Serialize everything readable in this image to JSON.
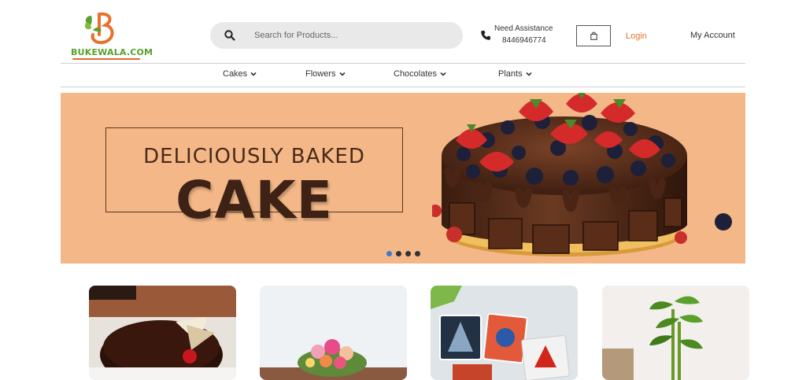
{
  "brand": {
    "name": "BUKEWALA.COM",
    "primary_green": "#5aa02c",
    "accent_orange": "#e8702a"
  },
  "search": {
    "placeholder": "Search for Products..."
  },
  "assistance": {
    "label": "Need Assistance",
    "phone": "8446946774"
  },
  "header": {
    "login_label": "Login",
    "account_label": "My Account"
  },
  "nav": {
    "items": [
      {
        "label": "Cakes"
      },
      {
        "label": "Flowers"
      },
      {
        "label": "Chocolates"
      },
      {
        "label": "Plants"
      }
    ]
  },
  "banner": {
    "line1": "DELICIOUSLY BAKED",
    "line2": "CAKE",
    "background": "#f4b888",
    "slide_count": 4,
    "active_slide": 1
  },
  "cards": [
    {
      "icon": "chocolate-cake-image"
    },
    {
      "icon": "flower-bouquet-image"
    },
    {
      "icon": "photo-magnets-image"
    },
    {
      "icon": "lucky-bamboo-plant-image"
    }
  ]
}
